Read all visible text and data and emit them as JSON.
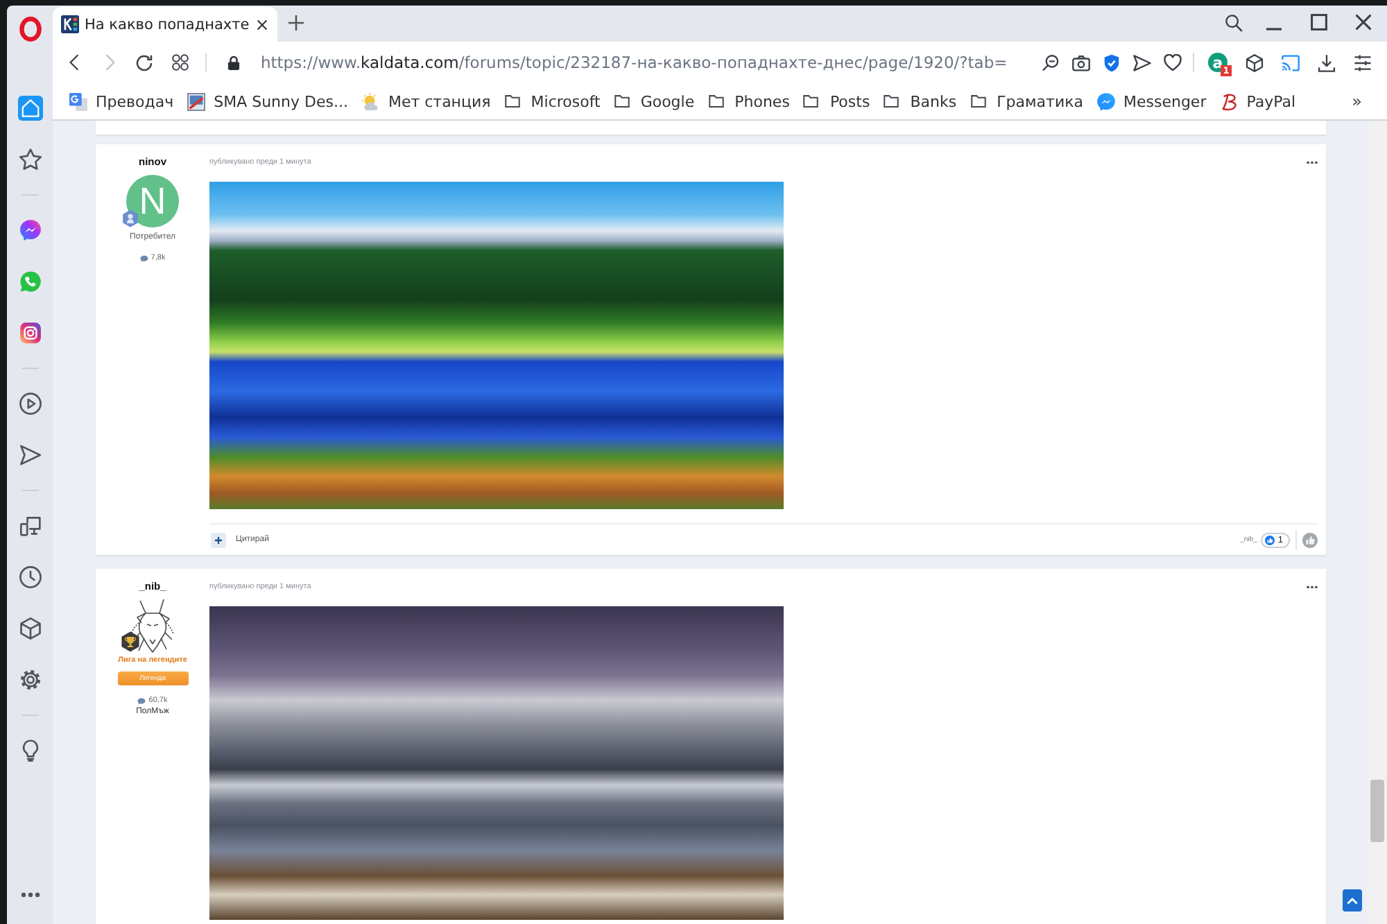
{
  "tabs": [
    {
      "title": "На какво попаднахте",
      "selected": true
    }
  ],
  "navigation": {
    "back_disabled": false,
    "forward_disabled": true
  },
  "address_bar": {
    "url_prefix": "https://www.",
    "url_domain": "kaldata.com",
    "url_path": "/forums/topic/232187-на-какво-попаднахте-днес/page/1920/?tab=",
    "extension_letter": "a",
    "extension_badge": "1"
  },
  "bookmarks": [
    {
      "label": "Преводач",
      "kind": "translate"
    },
    {
      "label": "SMA Sunny Des...",
      "kind": "image"
    },
    {
      "label": "Мет станция",
      "kind": "weather"
    },
    {
      "label": "Microsoft",
      "kind": "folder"
    },
    {
      "label": "Google",
      "kind": "folder"
    },
    {
      "label": "Phones",
      "kind": "folder"
    },
    {
      "label": "Posts",
      "kind": "folder"
    },
    {
      "label": "Banks",
      "kind": "folder"
    },
    {
      "label": "Граматика",
      "kind": "folder"
    },
    {
      "label": "Messenger",
      "kind": "chat"
    },
    {
      "label": "PayPal",
      "kind": "script"
    }
  ],
  "bookmarks_more": "»",
  "sidebar": {
    "groups": [
      [
        {
          "kind": "home",
          "selected": true
        },
        {
          "kind": "star",
          "selected": false
        }
      ],
      [
        {
          "kind": "chat",
          "selected": false
        },
        {
          "kind": "phone",
          "selected": false
        },
        {
          "kind": "camera",
          "selected": false
        }
      ],
      [
        {
          "kind": "play",
          "selected": false
        },
        {
          "kind": "send",
          "selected": false
        }
      ],
      [
        {
          "kind": "devices",
          "selected": false
        },
        {
          "kind": "clock",
          "selected": false
        },
        {
          "kind": "cube",
          "selected": false
        },
        {
          "kind": "gear",
          "selected": false
        }
      ],
      [
        {
          "kind": "bulb",
          "selected": false
        }
      ]
    ]
  },
  "posts": [
    {
      "author": "ninov",
      "avatar": {
        "kind": "letter",
        "letter": "N",
        "color": "#62c08a"
      },
      "badge": {
        "kind": "member"
      },
      "role": "Потребител",
      "post_count": "7,8k",
      "posted": "публикувано преди 1 минута",
      "photo": {
        "kind": "lake"
      },
      "footer": {
        "quote": "Цитирай",
        "reacted_by": "_nib_",
        "reaction_count": "1"
      }
    },
    {
      "author": "_nib_",
      "avatar": {
        "kind": "drawing"
      },
      "badge": {
        "kind": "trophy"
      },
      "group": "Лига на легендите",
      "rank": "Легенда",
      "post_count": "60,7k",
      "gender": "ПолМъж",
      "posted": "публикувано преди 1 минута",
      "photo": {
        "kind": "mountains"
      }
    }
  ]
}
